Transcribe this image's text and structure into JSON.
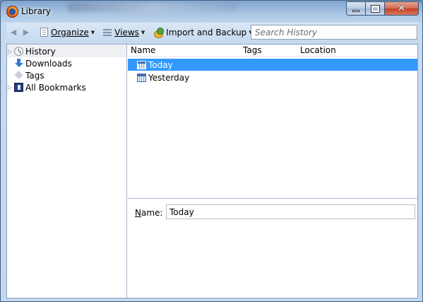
{
  "window": {
    "title": "Library"
  },
  "toolbar": {
    "back_icon": "back-arrow-icon",
    "forward_icon": "forward-arrow-icon",
    "organize_label": "Organize",
    "views_label": "Views",
    "import_label": "Import and Backup",
    "search_placeholder": "Search History"
  },
  "sidebar": {
    "items": [
      {
        "label": "History",
        "icon": "clock-icon",
        "expandable": true
      },
      {
        "label": "Downloads",
        "icon": "download-arrow-icon",
        "expandable": false
      },
      {
        "label": "Tags",
        "icon": "tag-icon",
        "expandable": false
      },
      {
        "label": "All Bookmarks",
        "icon": "bookmarks-folder-icon",
        "expandable": true
      }
    ]
  },
  "list": {
    "columns": [
      "Name",
      "Tags",
      "Location"
    ],
    "rows": [
      {
        "name": "Today",
        "selected": true
      },
      {
        "name": "Yesterday",
        "selected": false
      }
    ]
  },
  "details": {
    "name_label": "Name:",
    "name_value": "Today"
  },
  "colors": {
    "selection": "#3399ff",
    "close_button": "#c23f24"
  }
}
